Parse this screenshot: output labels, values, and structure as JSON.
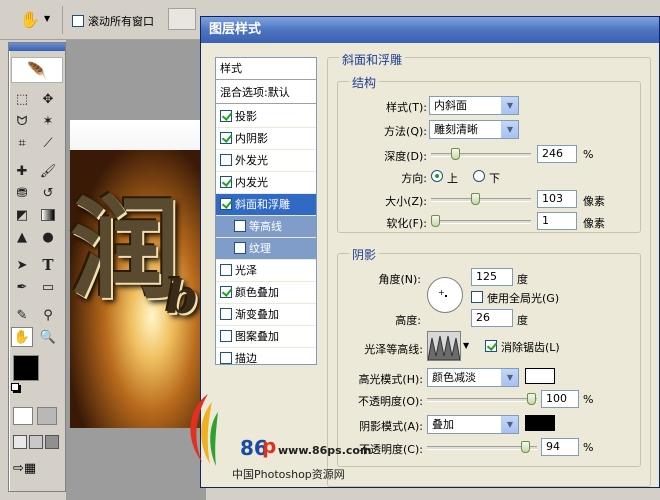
{
  "options_bar": {
    "tool_icon": "hand-icon",
    "scroll_all_label": "滚动所有窗口",
    "scroll_all_checked": false
  },
  "toolbox": {
    "tools": [
      "marquee-icon",
      "move-icon",
      "lasso-icon",
      "magic-wand-icon",
      "crop-icon",
      "slice-icon",
      "healing-brush-icon",
      "brush-icon",
      "clone-stamp-icon",
      "history-brush-icon",
      "eraser-icon",
      "gradient-icon",
      "blur-icon",
      "dodge-icon",
      "path-select-icon",
      "type-icon",
      "pen-icon",
      "shape-icon",
      "notes-icon",
      "eyedropper-icon",
      "hand-icon",
      "zoom-icon"
    ],
    "foreground_color": "#000000",
    "background_color": "#ffffff"
  },
  "canvas": {
    "char1": "润",
    "char2": "b"
  },
  "dialog": {
    "title": "图层样式",
    "style_list": {
      "header": "样式",
      "blend_options": "混合选项:默认",
      "items": [
        {
          "label": "投影",
          "checked": true
        },
        {
          "label": "内阴影",
          "checked": true
        },
        {
          "label": "外发光",
          "checked": false
        },
        {
          "label": "内发光",
          "checked": true
        },
        {
          "label": "斜面和浮雕",
          "checked": true,
          "selected": true
        },
        {
          "label": "等高线",
          "checked": false,
          "sub": true
        },
        {
          "label": "纹理",
          "checked": false,
          "sub": true
        },
        {
          "label": "光泽",
          "checked": false
        },
        {
          "label": "颜色叠加",
          "checked": true
        },
        {
          "label": "渐变叠加",
          "checked": false
        },
        {
          "label": "图案叠加",
          "checked": false
        },
        {
          "label": "描边",
          "checked": false
        }
      ]
    },
    "bevel_emboss": {
      "title": "斜面和浮雕",
      "structure": {
        "title": "结构",
        "style_label": "样式(T):",
        "style_value": "内斜面",
        "technique_label": "方法(Q):",
        "technique_value": "雕刻清晰",
        "depth_label": "深度(D):",
        "depth_value": "246",
        "depth_unit": "%",
        "direction_label": "方向:",
        "dir_up": "上",
        "dir_down": "下",
        "size_label": "大小(Z):",
        "size_value": "103",
        "size_unit": "像素",
        "soften_label": "软化(F):",
        "soften_value": "1",
        "soften_unit": "像素"
      },
      "shading": {
        "title": "阴影",
        "angle_label": "角度(N):",
        "angle_value": "125",
        "angle_unit": "度",
        "global_light_label": "使用全局光(G)",
        "altitude_label": "高度:",
        "altitude_value": "26",
        "altitude_unit": "度",
        "gloss_label": "光泽等高线:",
        "antialias_label": "消除锯齿(L)",
        "highlight_mode_label": "高光模式(H):",
        "highlight_mode_value": "颜色减淡",
        "highlight_color": "#ffffff",
        "highlight_opacity_label": "不透明度(O):",
        "highlight_opacity_value": "100",
        "highlight_opacity_unit": "%",
        "shadow_mode_label": "阴影模式(A):",
        "shadow_mode_value": "叠加",
        "shadow_color": "#000000",
        "shadow_opacity_label": "不透明度(C):",
        "shadow_opacity_value": "94",
        "shadow_opacity_unit": "%"
      }
    }
  },
  "watermark": {
    "url": "www.86ps.com",
    "brand": "86",
    "site_name": "中国Photoshop资源网"
  }
}
